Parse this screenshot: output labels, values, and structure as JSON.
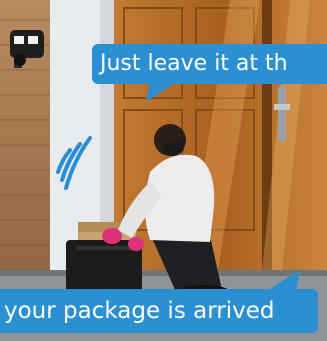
{
  "speech": {
    "top": "Just leave it at th",
    "bottom": "your package is arrived"
  },
  "icons": {
    "camera": "security-camera-icon",
    "waves": "wireless-signal-icon"
  },
  "colors": {
    "bubble": "#2b8fd3",
    "bubble_text": "#ffffff",
    "door": "#b06a2a",
    "glove": "#e0307a"
  }
}
